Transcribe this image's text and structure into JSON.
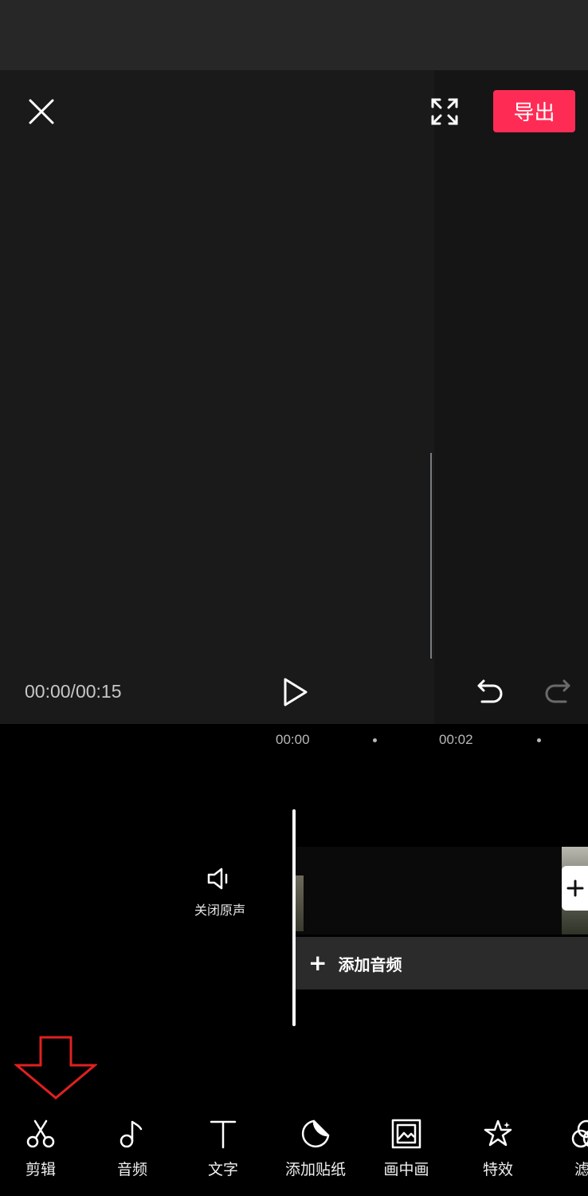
{
  "header": {
    "export_label": "导出"
  },
  "icons": {
    "close": "close-icon",
    "fullscreen": "fullscreen-icon",
    "play": "play-icon",
    "undo": "undo-icon",
    "redo": "redo-icon",
    "mute": "speaker-icon"
  },
  "player": {
    "time": "00:00/00:15"
  },
  "timeline": {
    "ruler": [
      "00:00",
      "00:02"
    ],
    "mute_label": "关闭原声",
    "add_audio_label": "添加音频"
  },
  "toolbar": {
    "items": [
      {
        "label": "剪辑",
        "icon": "scissors-icon"
      },
      {
        "label": "音频",
        "icon": "music-note-icon"
      },
      {
        "label": "文字",
        "icon": "text-icon"
      },
      {
        "label": "添加贴纸",
        "icon": "sticker-icon"
      },
      {
        "label": "画中画",
        "icon": "picture-in-picture-icon"
      },
      {
        "label": "特效",
        "icon": "effects-star-icon"
      },
      {
        "label": "滤",
        "icon": "filter-icon"
      }
    ]
  },
  "colors": {
    "accent": "#fe2c55",
    "hint_arrow": "#e02020",
    "background": "#000000",
    "preview_bg": "#1a1a1b"
  }
}
